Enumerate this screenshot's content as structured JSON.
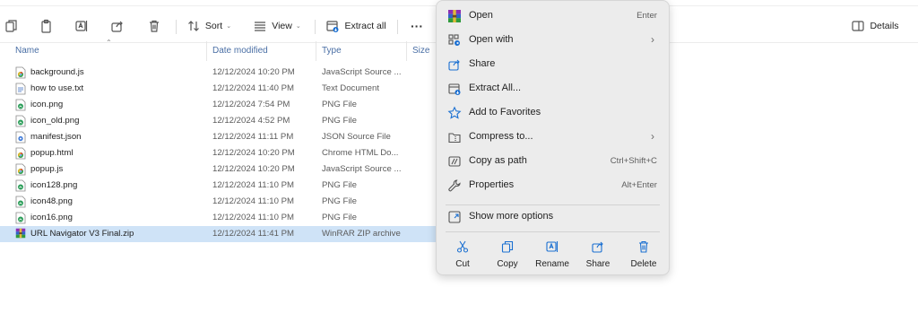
{
  "toolbar": {
    "sort_label": "Sort",
    "view_label": "View",
    "extract_label": "Extract all",
    "more_label": "···",
    "details_label": "Details",
    "icons": [
      "new-copy-icon",
      "paste-icon",
      "rename-icon",
      "share-icon",
      "delete-icon",
      "sort-icon",
      "view-icon",
      "extract-icon",
      "details-pane-icon"
    ]
  },
  "columns": {
    "name": "Name",
    "date": "Date modified",
    "type": "Type",
    "size": "Size"
  },
  "files": [
    {
      "name": "background.js",
      "date": "12/12/2024 10:20 PM",
      "type": "JavaScript Source ...",
      "icon": "chrome-file-icon"
    },
    {
      "name": "how to use.txt",
      "date": "12/12/2024 11:40 PM",
      "type": "Text Document",
      "icon": "text-file-icon"
    },
    {
      "name": "icon.png",
      "date": "12/12/2024 7:54 PM",
      "type": "PNG File",
      "icon": "image-file-icon"
    },
    {
      "name": "icon_old.png",
      "date": "12/12/2024 4:52 PM",
      "type": "PNG File",
      "icon": "image-file-icon"
    },
    {
      "name": "manifest.json",
      "date": "12/12/2024 11:11 PM",
      "type": "JSON Source File",
      "icon": "json-file-icon"
    },
    {
      "name": "popup.html",
      "date": "12/12/2024 10:20 PM",
      "type": "Chrome HTML Do...",
      "icon": "chrome-file-icon"
    },
    {
      "name": "popup.js",
      "date": "12/12/2024 10:20 PM",
      "type": "JavaScript Source ...",
      "icon": "chrome-file-icon"
    },
    {
      "name": "icon128.png",
      "date": "12/12/2024 11:10 PM",
      "type": "PNG File",
      "icon": "image-file-icon"
    },
    {
      "name": "icon48.png",
      "date": "12/12/2024 11:10 PM",
      "type": "PNG File",
      "icon": "image-file-icon"
    },
    {
      "name": "icon16.png",
      "date": "12/12/2024 11:10 PM",
      "type": "PNG File",
      "icon": "image-file-icon"
    },
    {
      "name": "URL Navigator V3 Final.zip",
      "date": "12/12/2024 11:41 PM",
      "type": "WinRAR ZIP archive",
      "icon": "winrar-icon",
      "selected": true
    }
  ],
  "context_menu": {
    "items": [
      {
        "label": "Open",
        "shortcut": "Enter",
        "icon": "winrar-icon"
      },
      {
        "label": "Open with",
        "submenu": true,
        "icon": "open-with-icon"
      },
      {
        "label": "Share",
        "icon": "share-icon"
      },
      {
        "label": "Extract All...",
        "icon": "extract-icon"
      },
      {
        "label": "Add to Favorites",
        "icon": "star-icon"
      },
      {
        "label": "Compress to...",
        "submenu": true,
        "icon": "compress-icon"
      },
      {
        "label": "Copy as path",
        "shortcut": "Ctrl+Shift+C",
        "icon": "copy-path-icon"
      },
      {
        "label": "Properties",
        "shortcut": "Alt+Enter",
        "icon": "wrench-icon"
      },
      {
        "label": "Show more options",
        "icon": "more-options-icon"
      }
    ],
    "quick_actions": [
      {
        "label": "Cut",
        "icon": "scissors-icon"
      },
      {
        "label": "Copy",
        "icon": "copy-icon"
      },
      {
        "label": "Rename",
        "icon": "rename-icon"
      },
      {
        "label": "Share",
        "icon": "share-icon"
      },
      {
        "label": "Delete",
        "icon": "trash-icon"
      }
    ],
    "submenu_arrow": "›"
  },
  "colors": {
    "selection": "#cfe3f7",
    "menu_bg": "#ececec",
    "header_text": "#4a6fa5",
    "accent": "#1a6fd1"
  }
}
